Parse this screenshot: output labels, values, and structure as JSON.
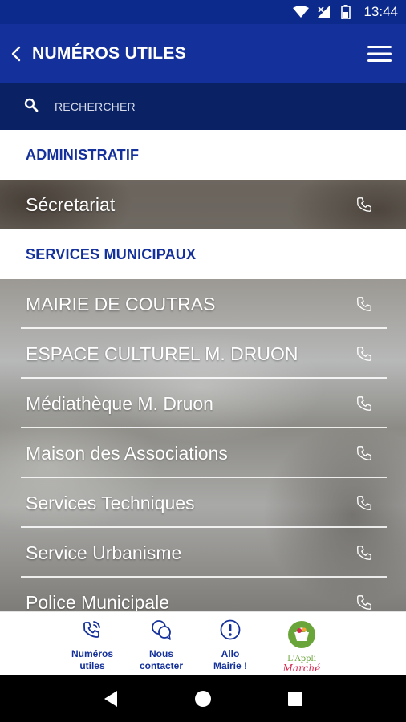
{
  "status_bar": {
    "time": "13:44",
    "icons": [
      "wifi-icon",
      "signal-icon",
      "battery-icon"
    ]
  },
  "app_bar": {
    "title": "NUMÉROS UTILES",
    "back_icon": "chevron-left-icon",
    "menu_icon": "hamburger-menu-icon"
  },
  "search": {
    "placeholder": "RECHERCHER",
    "icon": "search-icon"
  },
  "sections": [
    {
      "header": "ADMINISTRATIF",
      "items": [
        {
          "label": "Sécretariat"
        }
      ]
    },
    {
      "header": "SERVICES MUNICIPAUX",
      "items": [
        {
          "label": "MAIRIE DE COUTRAS"
        },
        {
          "label": "ESPACE CULTUREL M. DRUON"
        },
        {
          "label": "Médiathèque M. Druon"
        },
        {
          "label": "Maison des Associations"
        },
        {
          "label": "Services Techniques"
        },
        {
          "label": "Service Urbanisme"
        },
        {
          "label": "Police Municipale"
        }
      ]
    }
  ],
  "bottom_nav": [
    {
      "label": "Numéros\nutiles",
      "icon": "phone-ring-icon"
    },
    {
      "label": "Nous\ncontacter",
      "icon": "chat-bubbles-icon"
    },
    {
      "label": "Allo\nMairie !",
      "icon": "exclamation-circle-icon"
    }
  ],
  "logo": {
    "line1": "L'Appli",
    "line2": "Marché",
    "icon": "basket-logo-icon"
  },
  "colors": {
    "primary": "#14309a",
    "status_bar": "#0b2a8c",
    "search_bar": "#0a2164",
    "logo_green": "#6aa53a",
    "logo_red": "#d8264d"
  }
}
